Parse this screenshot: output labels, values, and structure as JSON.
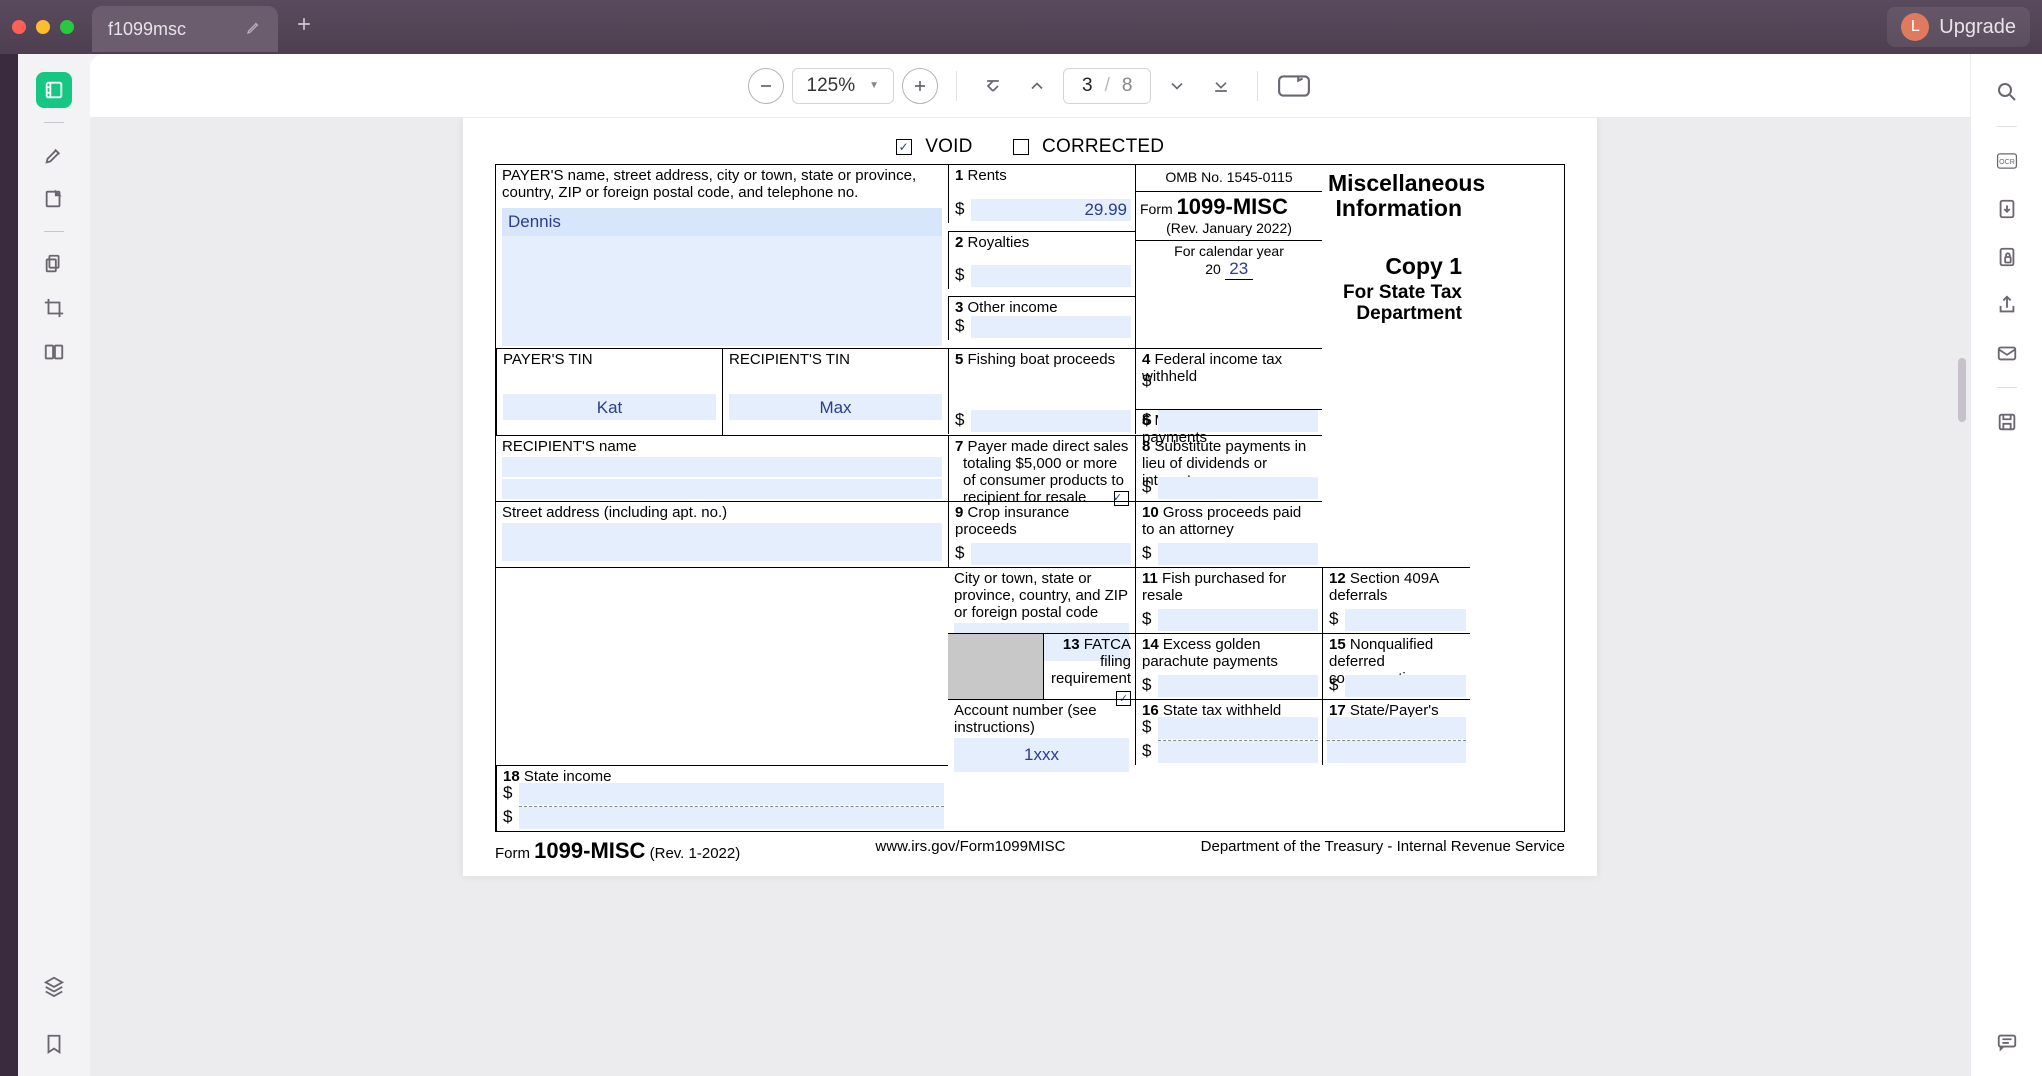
{
  "titlebar": {
    "tab_label": "f1099msc",
    "avatar_initial": "L",
    "upgrade_label": "Upgrade"
  },
  "toolbar": {
    "zoom_value": "125%",
    "page_current": "3",
    "page_total": "8"
  },
  "form": {
    "check_void": true,
    "void_label": "VOID",
    "check_corrected": false,
    "corrected_label": "CORRECTED",
    "payer_header": "PAYER'S name, street address, city or town, state or province, country, ZIP or foreign postal code, and telephone no.",
    "payer_name_value": "Dennis",
    "box1_label": "Rents",
    "box1_value": "29.99",
    "box2_label": "Royalties",
    "box3_label": "Other income",
    "box4_label": "Federal income tax withheld",
    "box5_label": "Fishing boat proceeds",
    "box6_label": "Medical and health care payments",
    "box7_label": "Payer made direct sales totaling $5,000 or more of consumer products to recipient for resale",
    "box7_checked": true,
    "box8_label": "Substitute payments in lieu of dividends or interest",
    "box9_label": "Crop insurance proceeds",
    "box10_label": "Gross proceeds paid to an attorney",
    "box11_label": "Fish purchased for resale",
    "box12_label": "Section 409A deferrals",
    "box13_label": "FATCA filing requirement",
    "box13_checked": true,
    "box14_label": "Excess golden parachute payments",
    "box15_label": "Nonqualified deferred compensation",
    "box16_label": "State tax withheld",
    "box17_label": "State/Payer's state no.",
    "box18_label": "State income",
    "payer_tin_label": "PAYER'S TIN",
    "payer_tin_value": "Kat",
    "recip_tin_label": "RECIPIENT'S TIN",
    "recip_tin_value": "Max",
    "recip_name_label": "RECIPIENT'S name",
    "street_label": "Street address (including apt. no.)",
    "city_label": "City or town, state or province, country, and ZIP or foreign postal code",
    "account_label": "Account number (see instructions)",
    "account_value": "1xxx",
    "omb": "OMB No. 1545-0115",
    "form_name_prefix": "Form",
    "form_name": "1099-MISC",
    "form_rev": "(Rev. January 2022)",
    "cal_year_label": "For calendar year",
    "cal_year_prefix": "20",
    "cal_year_value": "23",
    "title_line1": "Miscellaneous",
    "title_line2": "Information",
    "copy_label": "Copy 1",
    "dest_line1": "For State Tax",
    "dest_line2": "Department",
    "foot_left_prefix": "Form",
    "foot_left_form": "1099-MISC",
    "foot_left_rev": "(Rev. 1-2022)",
    "foot_center": "www.irs.gov/Form1099MISC",
    "foot_right": "Department of the Treasury - Internal Revenue Service"
  }
}
